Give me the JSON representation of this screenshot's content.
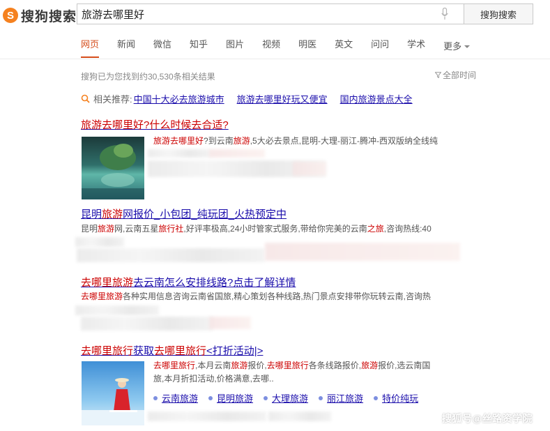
{
  "header": {
    "logo_mark": "S",
    "logo_text": "搜狗搜索",
    "query": "旅游去哪里好",
    "search_button": "搜狗搜索"
  },
  "nav": {
    "tabs": [
      "网页",
      "新闻",
      "微信",
      "知乎",
      "图片",
      "视频",
      "明医",
      "英文",
      "问问",
      "学术"
    ],
    "more": "更多"
  },
  "stats": {
    "result_count": "搜狗已为您找到约30,530条相关结果",
    "all_time": "全部时间"
  },
  "related": {
    "label": "相关推荐:",
    "items": [
      "中国十大必去旅游城市",
      "旅游去哪里好玩又便宜",
      "国内旅游景点大全"
    ]
  },
  "results": [
    {
      "title_hl": "旅游去哪里好",
      "title_rest": "?什么时候去合适?",
      "snippet": [
        {
          "t": "旅游去哪里好",
          "hl": true
        },
        {
          "t": "?到云南",
          "hl": false
        },
        {
          "t": "旅游",
          "hl": true
        },
        {
          "t": ",5大必去景点,昆明-大理-丽江-腾冲-西双版纳全线纯",
          "hl": false
        }
      ]
    },
    {
      "title_pre": "昆明",
      "title_hl": "旅游",
      "title_rest": "网报价_小包团_纯玩团_火热预定中",
      "snippet": [
        {
          "t": "昆明",
          "hl": false
        },
        {
          "t": "旅游",
          "hl": true
        },
        {
          "t": "网,云南五星",
          "hl": false
        },
        {
          "t": "旅行社",
          "hl": true
        },
        {
          "t": ",好评率极高,24小时管家式服务,带给你完美的云南",
          "hl": false
        },
        {
          "t": "之旅",
          "hl": true
        },
        {
          "t": ",咨询热线:40",
          "hl": false
        }
      ]
    },
    {
      "title_hl": "去哪里旅游",
      "title_rest": "去云南怎么安排线路?点击了解详情",
      "snippet": [
        {
          "t": "去哪里旅游",
          "hl": true
        },
        {
          "t": "各种实用信息咨询云南省国旅,精心策划各种线路,热门景点安排带你玩转云南,咨询热",
          "hl": false
        }
      ]
    },
    {
      "title_hl": "去哪里旅行",
      "title_mid": "获取",
      "title_hl2": "去哪里旅行",
      "title_rest": "<打折活动|>",
      "snippet_line1": [
        {
          "t": "去哪里旅行",
          "hl": true
        },
        {
          "t": ",本月云南",
          "hl": false
        },
        {
          "t": "旅游",
          "hl": true
        },
        {
          "t": "报价,",
          "hl": false
        },
        {
          "t": "去哪里旅行",
          "hl": true
        },
        {
          "t": "各条线路报价,",
          "hl": false
        },
        {
          "t": "旅游",
          "hl": true
        },
        {
          "t": "报价,选云南国",
          "hl": false
        }
      ],
      "snippet_line2": "旅,本月折扣活动,价格满意,去哪..",
      "sitelinks": [
        "云南旅游",
        "昆明旅游",
        "大理旅游",
        "丽江旅游",
        "特价纯玩"
      ]
    }
  ],
  "watermark": "搜狐号@丝路资学院"
}
